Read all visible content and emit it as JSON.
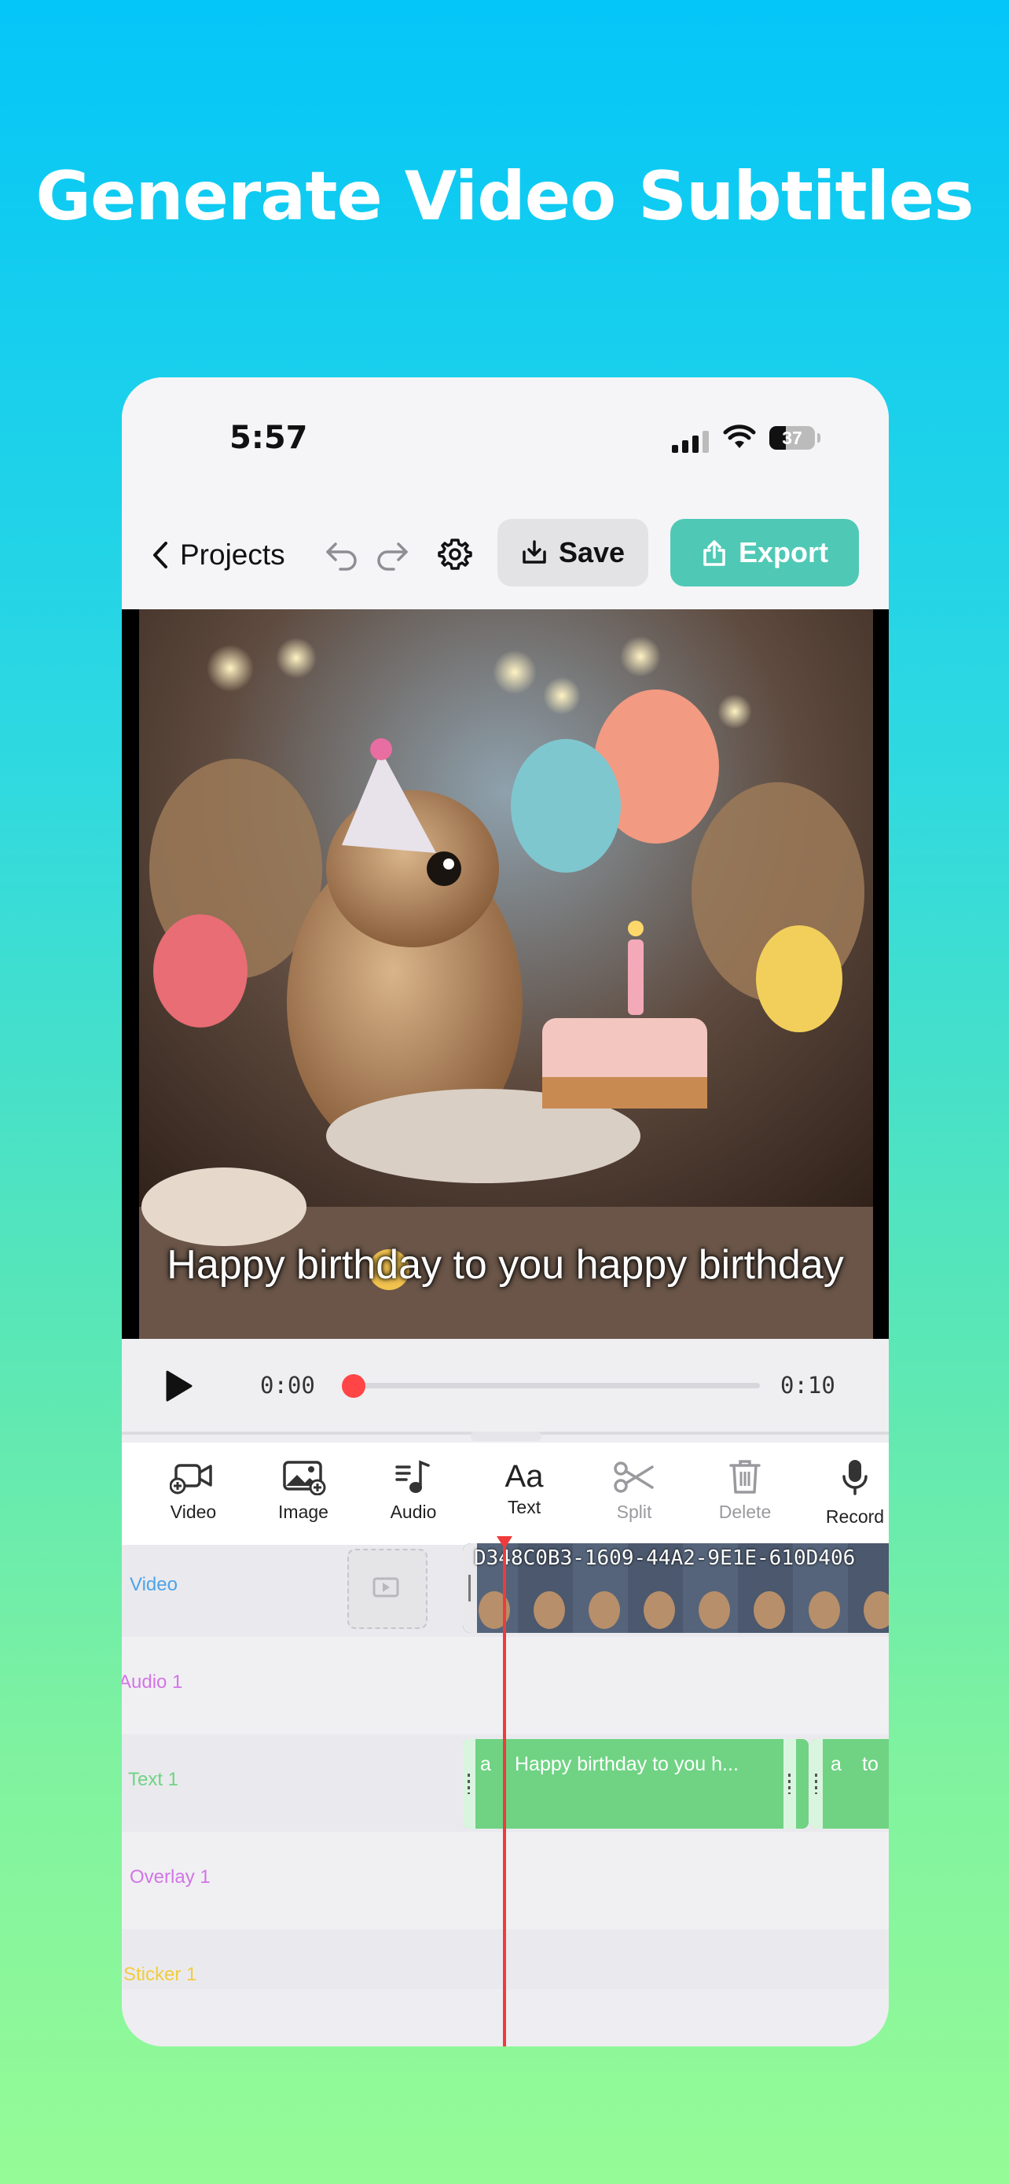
{
  "headline": "Generate Video Subtitles",
  "status": {
    "time": "5:57",
    "battery": "37",
    "battery_level": 0.37
  },
  "toolbar": {
    "back_label": "Projects",
    "save_label": "Save",
    "export_label": "Export"
  },
  "preview": {
    "subtitle": "Happy birthday to you happy birthday"
  },
  "player": {
    "current_time": "0:00",
    "duration": "0:10",
    "progress": 0.02
  },
  "tools": [
    {
      "label": "Video",
      "icon": "video-add-icon",
      "enabled": true
    },
    {
      "label": "Image",
      "icon": "image-add-icon",
      "enabled": true
    },
    {
      "label": "Audio",
      "icon": "music-note-icon",
      "enabled": true
    },
    {
      "label": "Text",
      "icon": "text-aa-icon",
      "enabled": true
    },
    {
      "label": "Split",
      "icon": "scissors-icon",
      "enabled": false
    },
    {
      "label": "Delete",
      "icon": "trash-icon",
      "enabled": false
    },
    {
      "label": "Record",
      "icon": "microphone-icon",
      "enabled": true
    }
  ],
  "timeline": {
    "tracks": [
      {
        "label": "Video",
        "color": "#4ea3e8"
      },
      {
        "label": "Audio 1",
        "color": "#d275e6"
      },
      {
        "label": "Text 1",
        "color": "#6fd383"
      },
      {
        "label": "Overlay 1",
        "color": "#d275e6"
      },
      {
        "label": "Sticker 1",
        "color": "#f2cc3d"
      }
    ],
    "video_clip_title": "D348C0B3-1609-44A2-9E1E-610D406",
    "text_clips": [
      {
        "lead": "a",
        "caption": "Happy birthday to you h..."
      },
      {
        "lead": "a",
        "caption": "to"
      }
    ]
  },
  "colors": {
    "accent": "#4fc9b5",
    "playhead": "#ef3b3b",
    "text_clip": "#6fd383"
  }
}
